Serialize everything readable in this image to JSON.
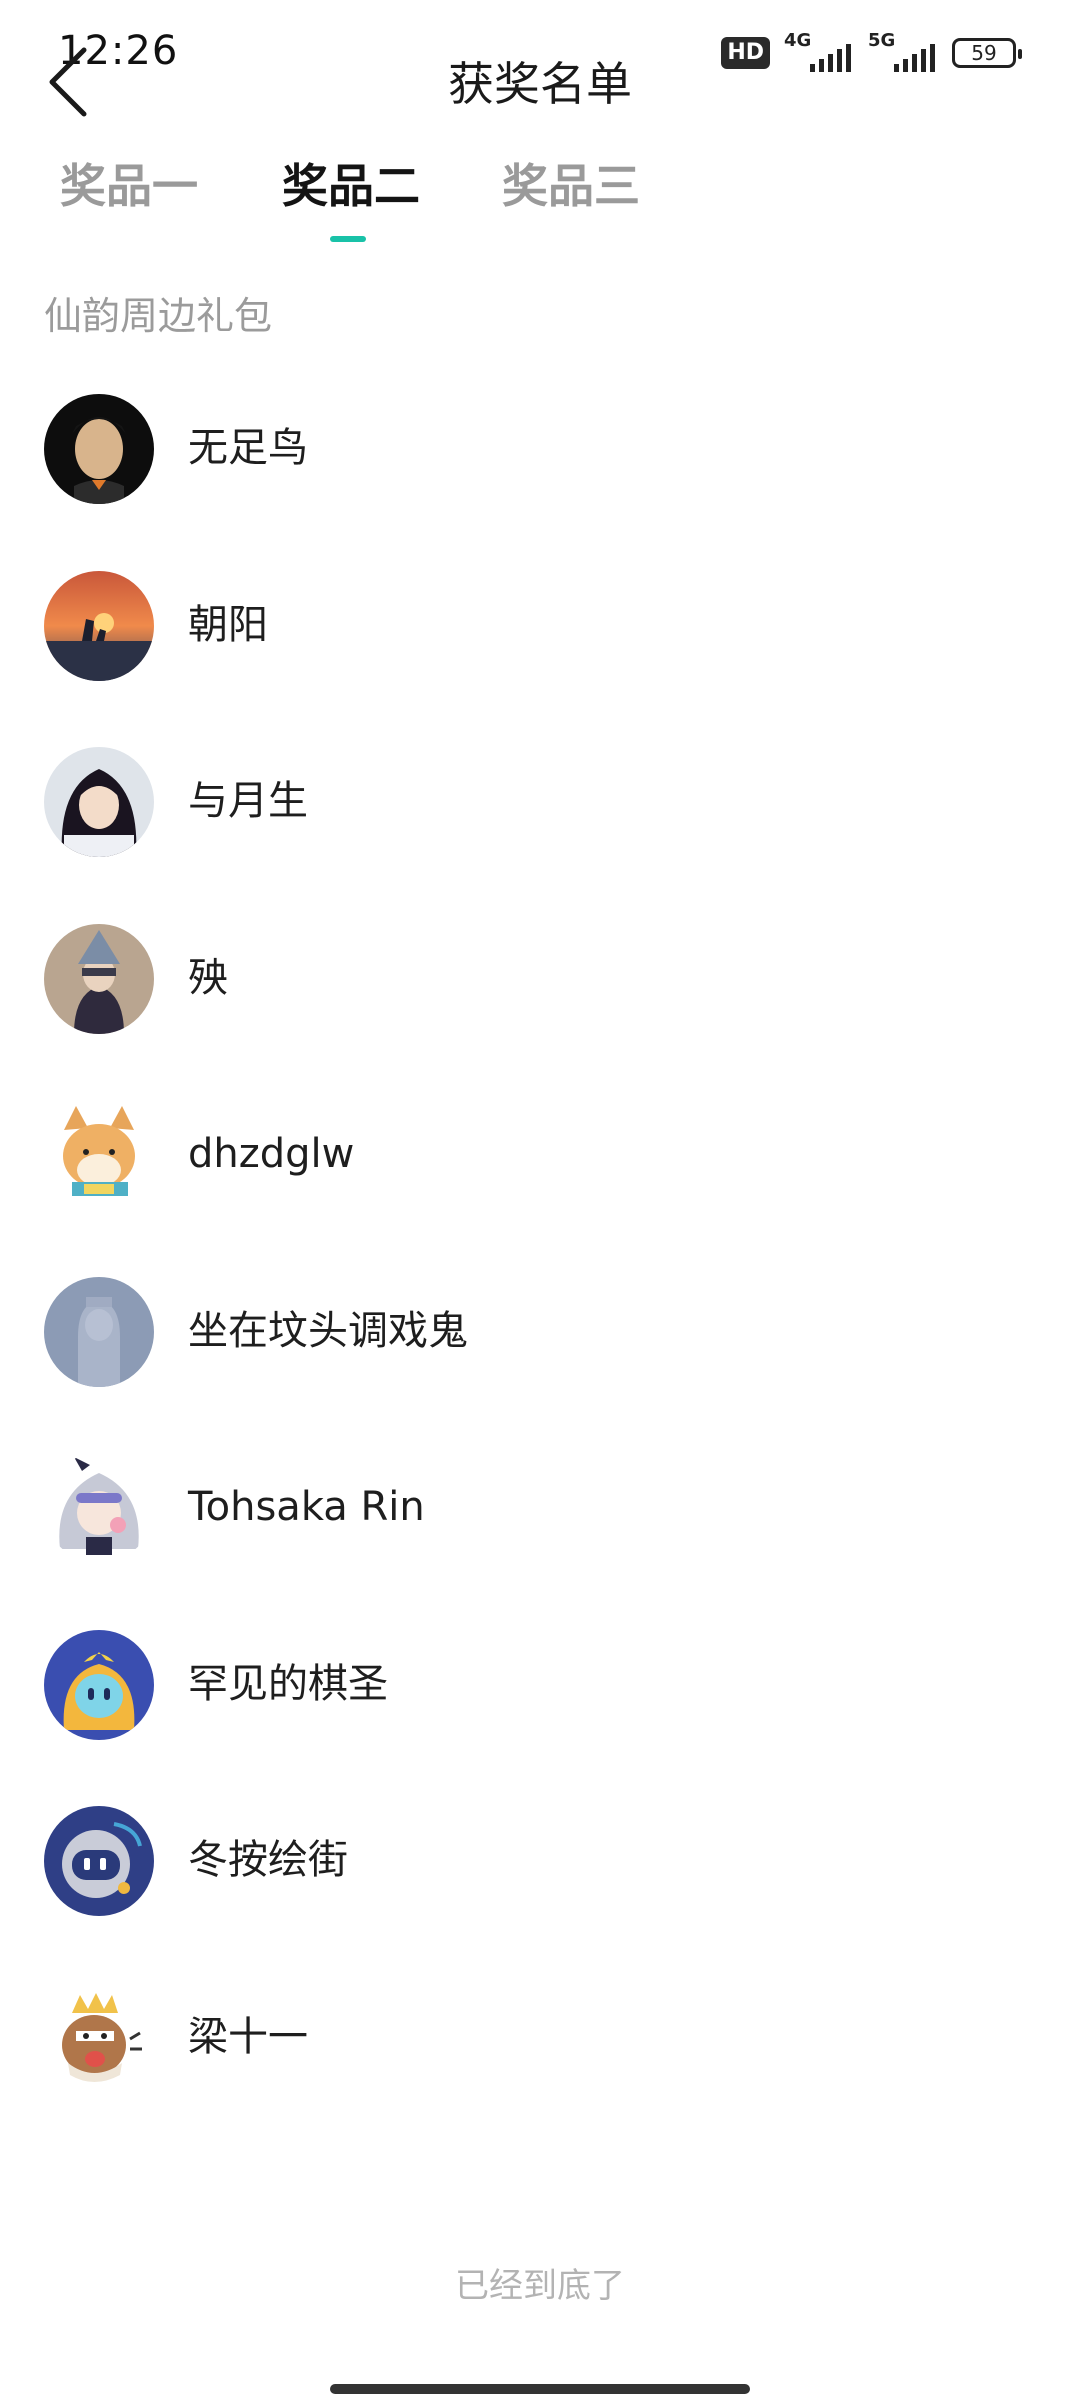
{
  "status_bar": {
    "time": "12:26",
    "hd_label": "HD",
    "net1_label": "4G",
    "net2_label": "5G",
    "battery": "59"
  },
  "header": {
    "title": "获奖名单",
    "back_icon": "chevron-left-icon"
  },
  "tabs": [
    {
      "label": "奖品一",
      "active": false
    },
    {
      "label": "奖品二",
      "active": true
    },
    {
      "label": "奖品三",
      "active": false
    }
  ],
  "accent_color": "#19c2a8",
  "prize_name": "仙韵周边礼包",
  "winners": [
    {
      "name": "无足鸟"
    },
    {
      "name": "朝阳"
    },
    {
      "name": "与月生"
    },
    {
      "name": "殃"
    },
    {
      "name": "dhzdglw"
    },
    {
      "name": "坐在坟头调戏鬼"
    },
    {
      "name": "Tohsaka Rin"
    },
    {
      "name": "罕见的棋圣"
    },
    {
      "name": "冬按绘街"
    },
    {
      "name": "梁十一"
    }
  ],
  "footer": {
    "end_text": "已经到底了"
  }
}
